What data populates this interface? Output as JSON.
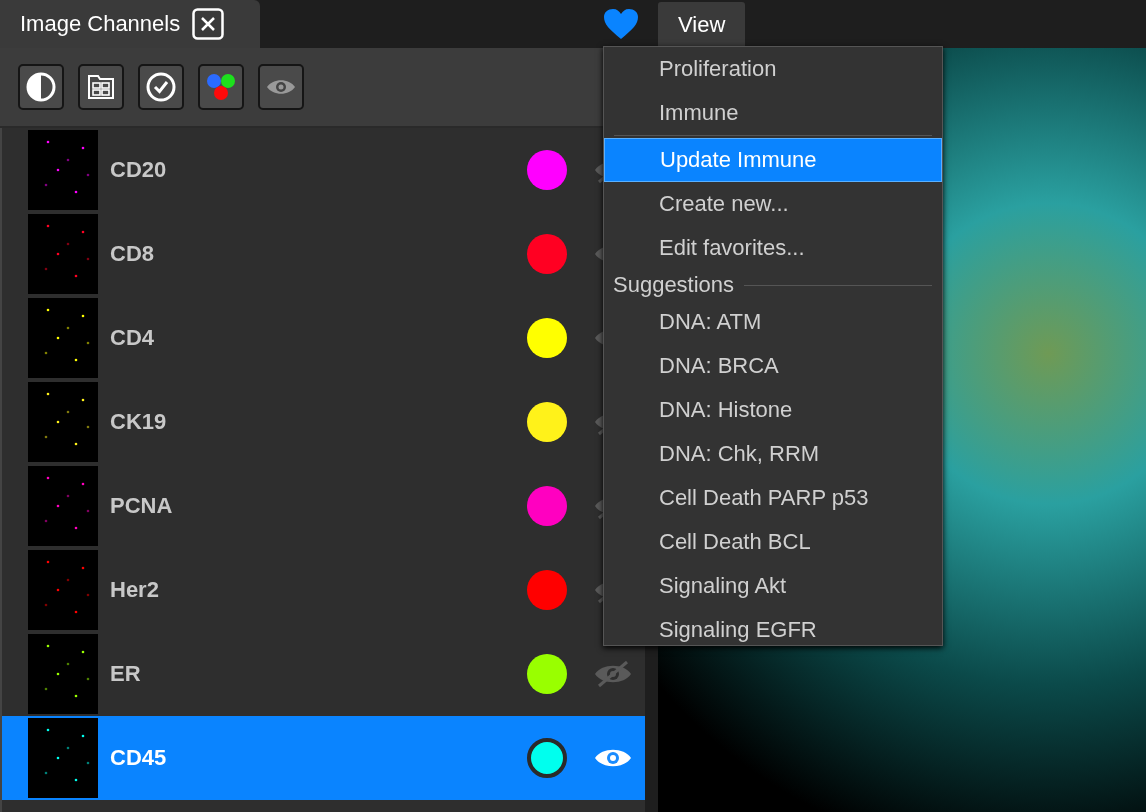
{
  "panel_tab": {
    "title": "Image Channels"
  },
  "toolbar": [
    {
      "kind": "contrast"
    },
    {
      "kind": "layout"
    },
    {
      "kind": "check"
    },
    {
      "kind": "colors"
    },
    {
      "kind": "eye"
    }
  ],
  "channels": [
    {
      "name": "CD20",
      "color": "#ff00ff",
      "visible": false,
      "selected": false
    },
    {
      "name": "CD8",
      "color": "#ff0022",
      "visible": true,
      "selected": false
    },
    {
      "name": "CD4",
      "color": "#ffff00",
      "visible": true,
      "selected": false
    },
    {
      "name": "CK19",
      "color": "#fff21a",
      "visible": false,
      "selected": false
    },
    {
      "name": "PCNA",
      "color": "#ff00c0",
      "visible": false,
      "selected": false
    },
    {
      "name": "Her2",
      "color": "#ff0000",
      "visible": false,
      "selected": false
    },
    {
      "name": "ER",
      "color": "#99ff00",
      "visible": false,
      "selected": false
    },
    {
      "name": "CD45",
      "color": "#00ffee",
      "visible": true,
      "selected": true
    }
  ],
  "view_tab": {
    "title": "View"
  },
  "favorites_menu": {
    "favorites": [
      {
        "label": "Proliferation",
        "selected": false
      },
      {
        "label": "Immune",
        "selected": false
      }
    ],
    "actions": [
      {
        "label": "Update Immune",
        "selected": true
      },
      {
        "label": "Create new...",
        "selected": false
      },
      {
        "label": "Edit favorites...",
        "selected": false
      }
    ],
    "suggestions_header": "Suggestions",
    "suggestions": [
      {
        "label": "DNA: ATM",
        "selected": false
      },
      {
        "label": "DNA: BRCA",
        "selected": false
      },
      {
        "label": "DNA: Histone",
        "selected": false
      },
      {
        "label": "DNA: Chk, RRM",
        "selected": false
      },
      {
        "label": "Cell Death PARP p53",
        "selected": false
      },
      {
        "label": "Cell Death BCL",
        "selected": false
      },
      {
        "label": "Signaling Akt",
        "selected": false
      },
      {
        "label": "Signaling EGFR",
        "selected": false
      }
    ]
  }
}
